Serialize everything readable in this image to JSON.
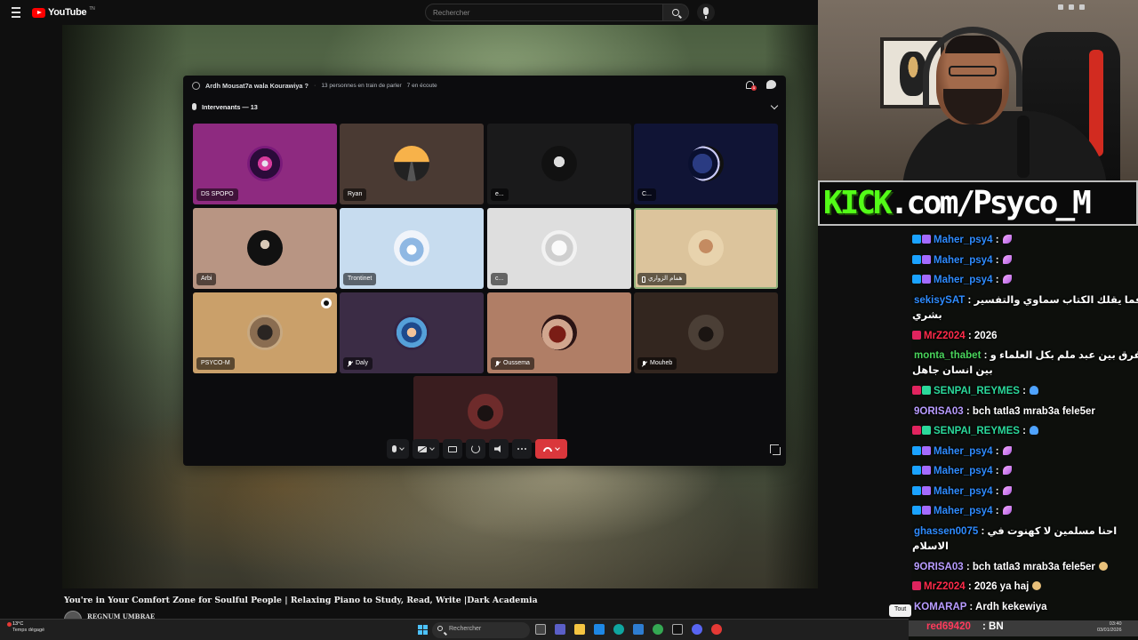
{
  "youtube": {
    "logo_text": "YouTube",
    "logo_sup": "TN",
    "search_placeholder": "Rechercher",
    "video_title": "You're in Your Comfort Zone for Soulful People | Relaxing Piano to Study, Read, Write |Dark Academia",
    "channel_name": "REGNUM UMBRAE",
    "chip": "Tout"
  },
  "discord": {
    "stage_title": "Ardh Mousat7a wala Kourawiya ?",
    "speakers_status": "13 personnes en train de parler",
    "listeners_status": "7 en écoute",
    "inbox_badge": "1",
    "speakers_header": "Intervenants — 13",
    "participants": [
      {
        "name": "DS SPOPO",
        "muted": false
      },
      {
        "name": "Ryan",
        "muted": false
      },
      {
        "name": "e...",
        "muted": false
      },
      {
        "name": "C...",
        "muted": false
      },
      {
        "name": "Arbi",
        "muted": false
      },
      {
        "name": "Trontinet",
        "muted": false
      },
      {
        "name": "c...",
        "muted": false
      },
      {
        "name": "همام الزواري",
        "muted": false,
        "mobile": true,
        "speaking": true
      },
      {
        "name": "PSYCO-M",
        "muted": false
      },
      {
        "name": "Daly",
        "muted": true
      },
      {
        "name": "Oussema",
        "muted": true
      },
      {
        "name": "Mouheb",
        "muted": false
      }
    ]
  },
  "stream": {
    "kick_brand": "KICK",
    "kick_rest": ".com/Psyco_M"
  },
  "chat": [
    {
      "user": "Maher_psy4",
      "color": "#2f8cff",
      "badges": [
        "blue",
        "pur"
      ],
      "text": ":",
      "emote": "feather"
    },
    {
      "user": "Maher_psy4",
      "color": "#2f8cff",
      "badges": [
        "blue",
        "pur"
      ],
      "text": ":",
      "emote": "feather"
    },
    {
      "user": "Maher_psy4",
      "color": "#2f8cff",
      "badges": [
        "blue",
        "pur"
      ],
      "text": ":",
      "emote": "feather"
    },
    {
      "user": "sekisySAT",
      "color": "#2f8cff",
      "badges": [],
      "text": ": فما يقلك الكتاب سماوي والتفسير",
      "line2": "بشري"
    },
    {
      "user": "MrZ2024",
      "color": "#ff2b4a",
      "badges": [
        "red"
      ],
      "text": ": 2026"
    },
    {
      "user": "monta_thabet",
      "color": "#49d35b",
      "badges": [],
      "text": ": الفرق بين عبد ملم بكل العلماء و",
      "line2": "بين انسان جاهل"
    },
    {
      "user": "SENPAI_REYMES",
      "color": "#2bd99b",
      "badges": [
        "red",
        "grn"
      ],
      "text": ":",
      "emote": "hand"
    },
    {
      "user": "9ORISA03",
      "color": "#b89cff",
      "badges": [],
      "text": ": bch tatla3 mrab3a fele5er"
    },
    {
      "user": "SENPAI_REYMES",
      "color": "#2bd99b",
      "badges": [
        "red",
        "grn"
      ],
      "text": ":",
      "emote": "hand"
    },
    {
      "user": "Maher_psy4",
      "color": "#2f8cff",
      "badges": [
        "blue",
        "pur"
      ],
      "text": ":",
      "emote": "feather"
    },
    {
      "user": "Maher_psy4",
      "color": "#2f8cff",
      "badges": [
        "blue",
        "pur"
      ],
      "text": ":",
      "emote": "feather"
    },
    {
      "user": "Maher_psy4",
      "color": "#2f8cff",
      "badges": [
        "blue",
        "pur"
      ],
      "text": ":",
      "emote": "feather"
    },
    {
      "user": "Maher_psy4",
      "color": "#2f8cff",
      "badges": [
        "blue",
        "pur"
      ],
      "text": ":",
      "emote": "feather"
    },
    {
      "user": "ghassen0075",
      "color": "#2f8cff",
      "badges": [],
      "text": ": احنا مسلمين لا كهنوت في",
      "line2": "الاسلام"
    },
    {
      "user": "9ORISA03",
      "color": "#b89cff",
      "badges": [],
      "text": ": bch tatla3 mrab3a fele5er",
      "emote": "face"
    },
    {
      "user": "MrZ2024",
      "color": "#ff2b4a",
      "badges": [
        "red"
      ],
      "text": ": 2026 ya haj",
      "emote": "face"
    },
    {
      "user": "KOMARAP",
      "color": "#b89cff",
      "badges": [],
      "text": ": Ardh kekewiya"
    }
  ],
  "chat_last": {
    "user": "red69420",
    "text": ": BN"
  },
  "taskbar": {
    "temp": "13°C",
    "weather": "Temps dégagé",
    "search_placeholder": "Rechercher",
    "time": "03:40",
    "date": "03/01/2026"
  }
}
